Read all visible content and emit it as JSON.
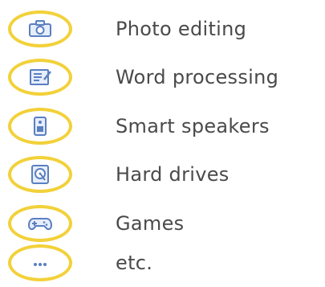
{
  "colors": {
    "ring": "#f2d13a",
    "icon": "#5b7fc0",
    "text": "#4a4a4a"
  },
  "items": [
    {
      "label": "Photo editing",
      "icon": "camera-icon"
    },
    {
      "label": "Word processing",
      "icon": "document-icon"
    },
    {
      "label": "Smart speakers",
      "icon": "speaker-icon"
    },
    {
      "label": "Hard drives",
      "icon": "hard-drive-icon"
    },
    {
      "label": "Games",
      "icon": "gamepad-icon"
    },
    {
      "label": "etc.",
      "icon": "ellipsis-icon"
    }
  ]
}
